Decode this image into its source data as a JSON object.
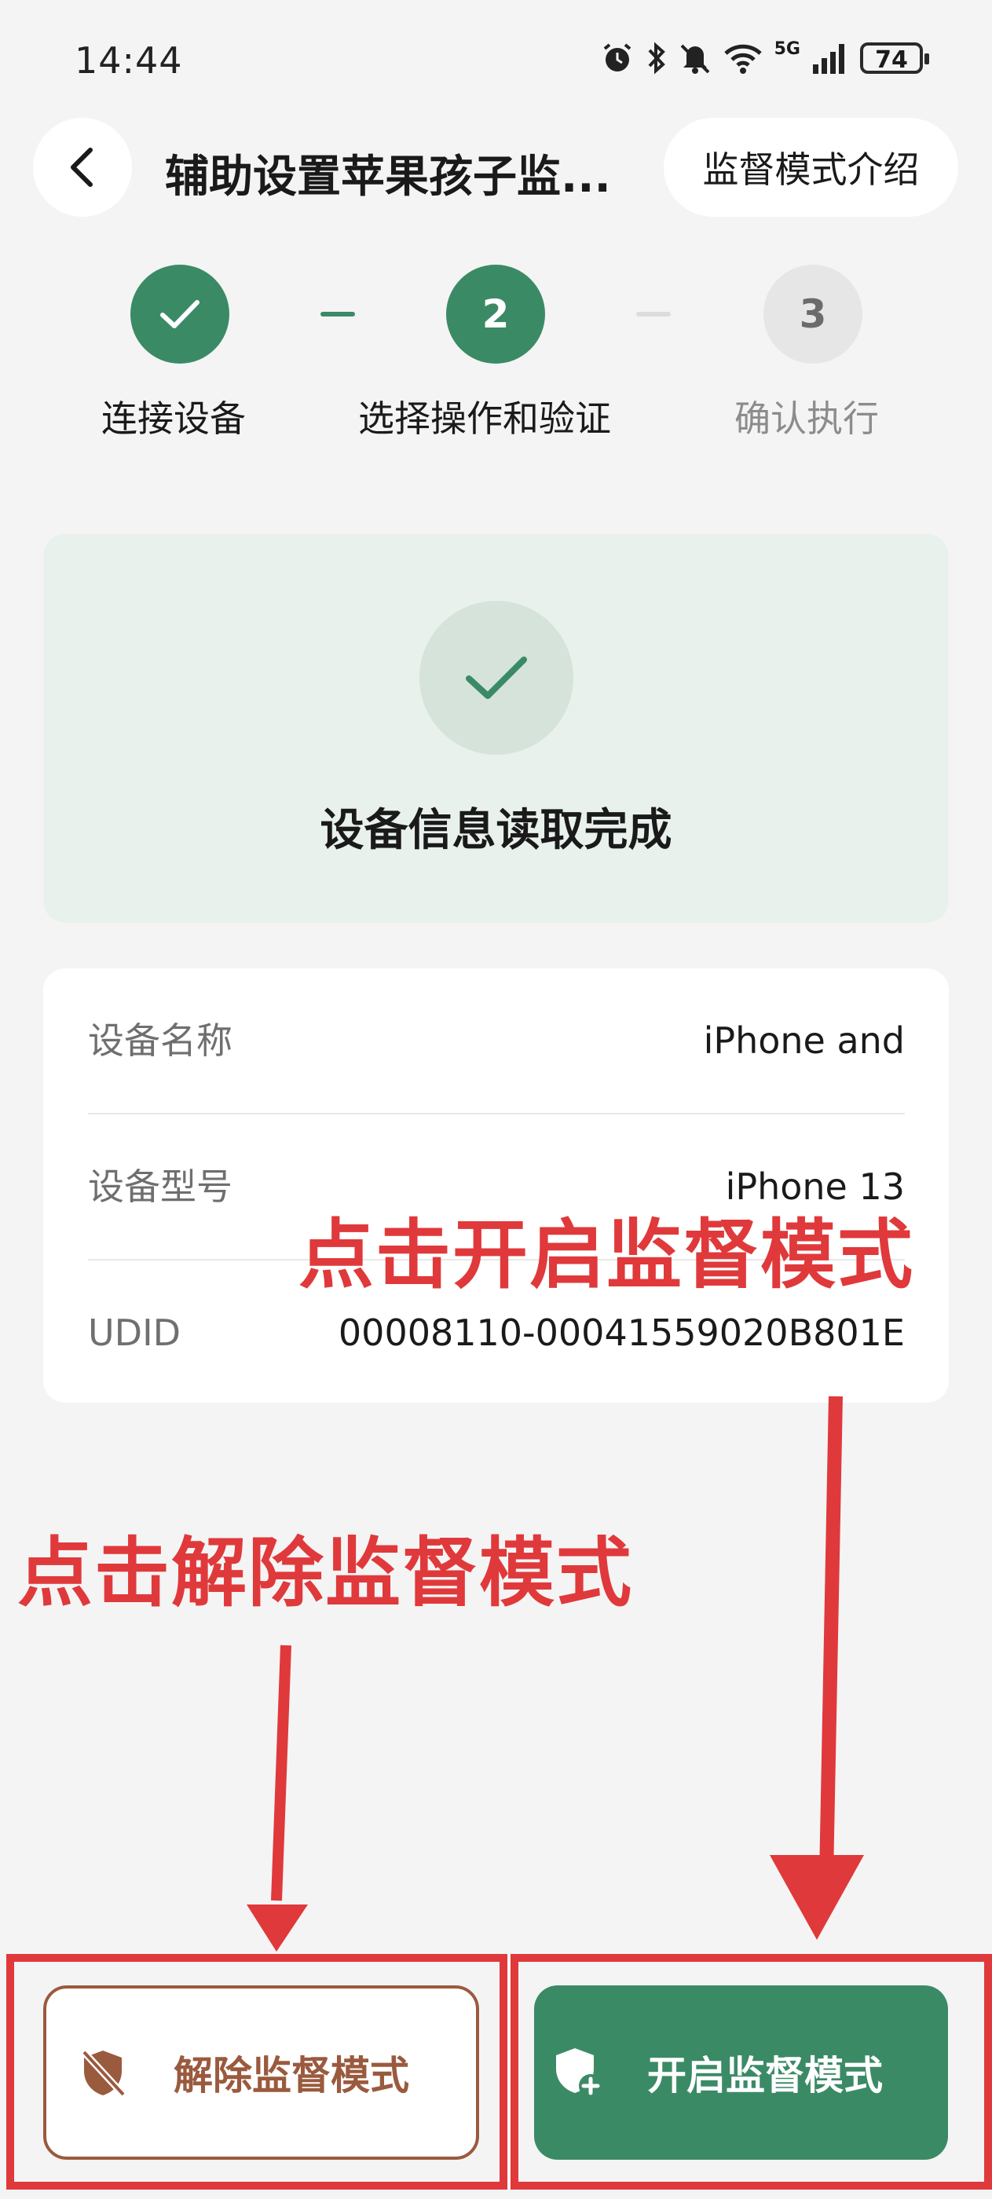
{
  "status_bar": {
    "time": "14:44",
    "network": "5G",
    "battery": "74",
    "icons": [
      "alarm-icon",
      "bluetooth-icon",
      "mute-icon",
      "wifi-icon",
      "signal-icon",
      "battery-icon"
    ]
  },
  "header": {
    "title": "辅助设置苹果孩子监...",
    "intro_button": "监督模式介绍"
  },
  "stepper": {
    "steps": [
      {
        "label": "连接设备",
        "number": "",
        "state": "done"
      },
      {
        "label": "选择操作和验证",
        "number": "2",
        "state": "active"
      },
      {
        "label": "确认执行",
        "number": "3",
        "state": "idle"
      }
    ]
  },
  "success": {
    "text": "设备信息读取完成"
  },
  "device_info": {
    "rows": [
      {
        "label": "设备名称",
        "value": "iPhone and"
      },
      {
        "label": "设备型号",
        "value": "iPhone 13"
      },
      {
        "label": "UDID",
        "value": "00008110-00041559020B801E"
      }
    ]
  },
  "annotations": {
    "enable_hint": "点击开启监督模式",
    "release_hint": "点击解除监督模式"
  },
  "buttons": {
    "release": "解除监督模式",
    "enable": "开启监督模式"
  },
  "colors": {
    "accent_green": "#3b8a66",
    "release_brown": "#9a5a3e",
    "annotation_red": "#e0393b",
    "success_bg": "#e9f1ec"
  }
}
